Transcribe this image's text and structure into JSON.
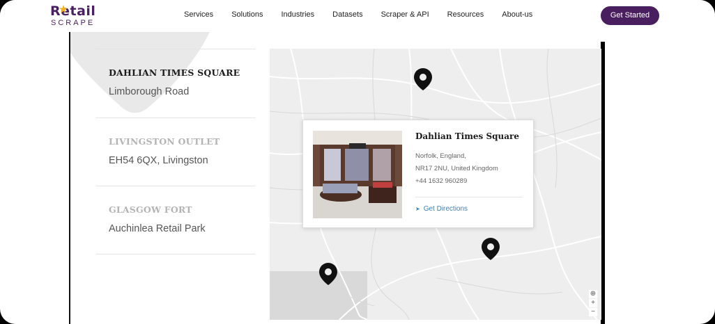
{
  "header": {
    "logo_top": "Retail",
    "logo_bottom": "SCRAPE",
    "nav": [
      "Services",
      "Solutions",
      "Industries",
      "Datasets",
      "Scraper & API",
      "Resources",
      "About-us"
    ],
    "cta_label": "Get Started"
  },
  "stores": [
    {
      "name": "DAHLIAN TIMES SQUARE",
      "address": "Limborough Road"
    },
    {
      "name": "LIVINGSTON OUTLET",
      "address": "EH54 6QX, Livingston"
    },
    {
      "name": "GLASGOW FORT",
      "address": "Auchinlea Retail Park"
    }
  ],
  "popup": {
    "title": "Dahlian Times Square",
    "line1": "Norfolk, England,",
    "line2": "NR17 2NU, United Kingdom",
    "line3": "+44 1632 960289",
    "link": "Get Directions"
  },
  "map": {
    "zoom_in": "+",
    "zoom_out": "−",
    "compass": "⊕"
  },
  "colors": {
    "brand": "#4a1f5f",
    "link": "#3f7fb8",
    "marker": "#111111"
  }
}
